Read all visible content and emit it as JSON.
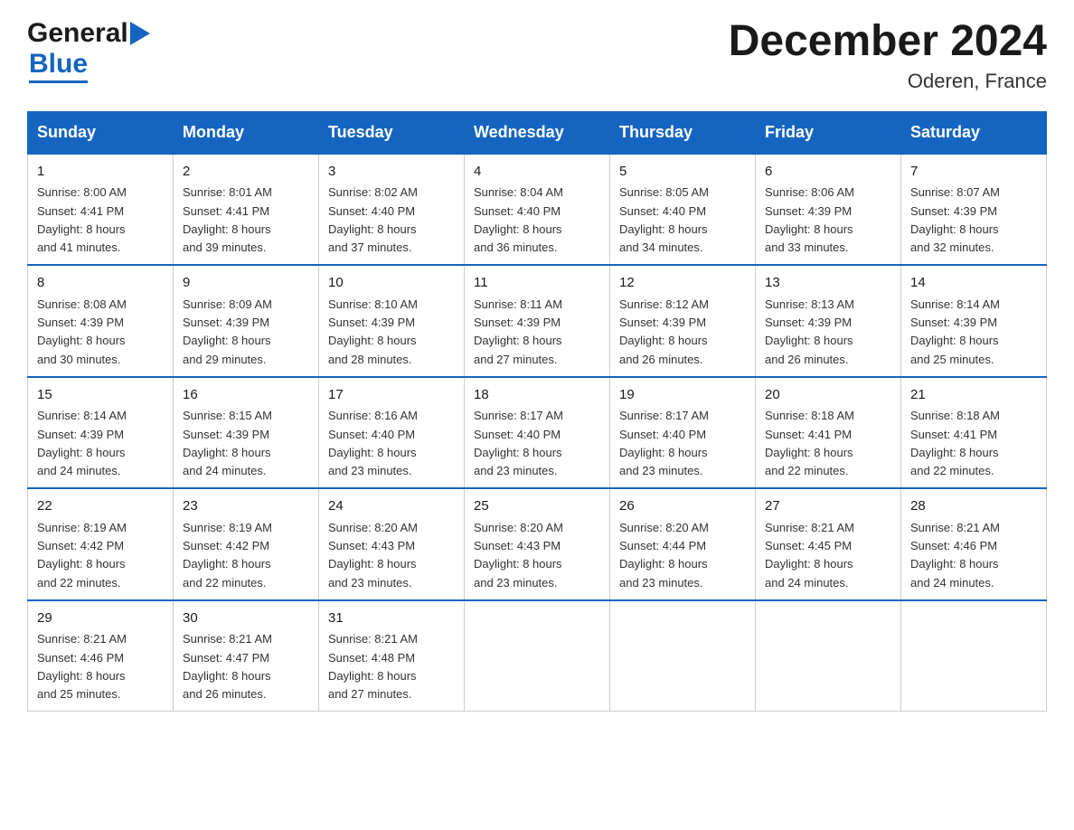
{
  "header": {
    "logo": {
      "general": "General",
      "arrow": "▶",
      "blue": "Blue"
    },
    "title": "December 2024",
    "location": "Oderen, France"
  },
  "calendar": {
    "days_of_week": [
      "Sunday",
      "Monday",
      "Tuesday",
      "Wednesday",
      "Thursday",
      "Friday",
      "Saturday"
    ],
    "weeks": [
      [
        {
          "date": "1",
          "sunrise": "Sunrise: 8:00 AM",
          "sunset": "Sunset: 4:41 PM",
          "daylight": "Daylight: 8 hours",
          "daylight2": "and 41 minutes."
        },
        {
          "date": "2",
          "sunrise": "Sunrise: 8:01 AM",
          "sunset": "Sunset: 4:41 PM",
          "daylight": "Daylight: 8 hours",
          "daylight2": "and 39 minutes."
        },
        {
          "date": "3",
          "sunrise": "Sunrise: 8:02 AM",
          "sunset": "Sunset: 4:40 PM",
          "daylight": "Daylight: 8 hours",
          "daylight2": "and 37 minutes."
        },
        {
          "date": "4",
          "sunrise": "Sunrise: 8:04 AM",
          "sunset": "Sunset: 4:40 PM",
          "daylight": "Daylight: 8 hours",
          "daylight2": "and 36 minutes."
        },
        {
          "date": "5",
          "sunrise": "Sunrise: 8:05 AM",
          "sunset": "Sunset: 4:40 PM",
          "daylight": "Daylight: 8 hours",
          "daylight2": "and 34 minutes."
        },
        {
          "date": "6",
          "sunrise": "Sunrise: 8:06 AM",
          "sunset": "Sunset: 4:39 PM",
          "daylight": "Daylight: 8 hours",
          "daylight2": "and 33 minutes."
        },
        {
          "date": "7",
          "sunrise": "Sunrise: 8:07 AM",
          "sunset": "Sunset: 4:39 PM",
          "daylight": "Daylight: 8 hours",
          "daylight2": "and 32 minutes."
        }
      ],
      [
        {
          "date": "8",
          "sunrise": "Sunrise: 8:08 AM",
          "sunset": "Sunset: 4:39 PM",
          "daylight": "Daylight: 8 hours",
          "daylight2": "and 30 minutes."
        },
        {
          "date": "9",
          "sunrise": "Sunrise: 8:09 AM",
          "sunset": "Sunset: 4:39 PM",
          "daylight": "Daylight: 8 hours",
          "daylight2": "and 29 minutes."
        },
        {
          "date": "10",
          "sunrise": "Sunrise: 8:10 AM",
          "sunset": "Sunset: 4:39 PM",
          "daylight": "Daylight: 8 hours",
          "daylight2": "and 28 minutes."
        },
        {
          "date": "11",
          "sunrise": "Sunrise: 8:11 AM",
          "sunset": "Sunset: 4:39 PM",
          "daylight": "Daylight: 8 hours",
          "daylight2": "and 27 minutes."
        },
        {
          "date": "12",
          "sunrise": "Sunrise: 8:12 AM",
          "sunset": "Sunset: 4:39 PM",
          "daylight": "Daylight: 8 hours",
          "daylight2": "and 26 minutes."
        },
        {
          "date": "13",
          "sunrise": "Sunrise: 8:13 AM",
          "sunset": "Sunset: 4:39 PM",
          "daylight": "Daylight: 8 hours",
          "daylight2": "and 26 minutes."
        },
        {
          "date": "14",
          "sunrise": "Sunrise: 8:14 AM",
          "sunset": "Sunset: 4:39 PM",
          "daylight": "Daylight: 8 hours",
          "daylight2": "and 25 minutes."
        }
      ],
      [
        {
          "date": "15",
          "sunrise": "Sunrise: 8:14 AM",
          "sunset": "Sunset: 4:39 PM",
          "daylight": "Daylight: 8 hours",
          "daylight2": "and 24 minutes."
        },
        {
          "date": "16",
          "sunrise": "Sunrise: 8:15 AM",
          "sunset": "Sunset: 4:39 PM",
          "daylight": "Daylight: 8 hours",
          "daylight2": "and 24 minutes."
        },
        {
          "date": "17",
          "sunrise": "Sunrise: 8:16 AM",
          "sunset": "Sunset: 4:40 PM",
          "daylight": "Daylight: 8 hours",
          "daylight2": "and 23 minutes."
        },
        {
          "date": "18",
          "sunrise": "Sunrise: 8:17 AM",
          "sunset": "Sunset: 4:40 PM",
          "daylight": "Daylight: 8 hours",
          "daylight2": "and 23 minutes."
        },
        {
          "date": "19",
          "sunrise": "Sunrise: 8:17 AM",
          "sunset": "Sunset: 4:40 PM",
          "daylight": "Daylight: 8 hours",
          "daylight2": "and 23 minutes."
        },
        {
          "date": "20",
          "sunrise": "Sunrise: 8:18 AM",
          "sunset": "Sunset: 4:41 PM",
          "daylight": "Daylight: 8 hours",
          "daylight2": "and 22 minutes."
        },
        {
          "date": "21",
          "sunrise": "Sunrise: 8:18 AM",
          "sunset": "Sunset: 4:41 PM",
          "daylight": "Daylight: 8 hours",
          "daylight2": "and 22 minutes."
        }
      ],
      [
        {
          "date": "22",
          "sunrise": "Sunrise: 8:19 AM",
          "sunset": "Sunset: 4:42 PM",
          "daylight": "Daylight: 8 hours",
          "daylight2": "and 22 minutes."
        },
        {
          "date": "23",
          "sunrise": "Sunrise: 8:19 AM",
          "sunset": "Sunset: 4:42 PM",
          "daylight": "Daylight: 8 hours",
          "daylight2": "and 22 minutes."
        },
        {
          "date": "24",
          "sunrise": "Sunrise: 8:20 AM",
          "sunset": "Sunset: 4:43 PM",
          "daylight": "Daylight: 8 hours",
          "daylight2": "and 23 minutes."
        },
        {
          "date": "25",
          "sunrise": "Sunrise: 8:20 AM",
          "sunset": "Sunset: 4:43 PM",
          "daylight": "Daylight: 8 hours",
          "daylight2": "and 23 minutes."
        },
        {
          "date": "26",
          "sunrise": "Sunrise: 8:20 AM",
          "sunset": "Sunset: 4:44 PM",
          "daylight": "Daylight: 8 hours",
          "daylight2": "and 23 minutes."
        },
        {
          "date": "27",
          "sunrise": "Sunrise: 8:21 AM",
          "sunset": "Sunset: 4:45 PM",
          "daylight": "Daylight: 8 hours",
          "daylight2": "and 24 minutes."
        },
        {
          "date": "28",
          "sunrise": "Sunrise: 8:21 AM",
          "sunset": "Sunset: 4:46 PM",
          "daylight": "Daylight: 8 hours",
          "daylight2": "and 24 minutes."
        }
      ],
      [
        {
          "date": "29",
          "sunrise": "Sunrise: 8:21 AM",
          "sunset": "Sunset: 4:46 PM",
          "daylight": "Daylight: 8 hours",
          "daylight2": "and 25 minutes."
        },
        {
          "date": "30",
          "sunrise": "Sunrise: 8:21 AM",
          "sunset": "Sunset: 4:47 PM",
          "daylight": "Daylight: 8 hours",
          "daylight2": "and 26 minutes."
        },
        {
          "date": "31",
          "sunrise": "Sunrise: 8:21 AM",
          "sunset": "Sunset: 4:48 PM",
          "daylight": "Daylight: 8 hours",
          "daylight2": "and 27 minutes."
        },
        null,
        null,
        null,
        null
      ]
    ]
  }
}
